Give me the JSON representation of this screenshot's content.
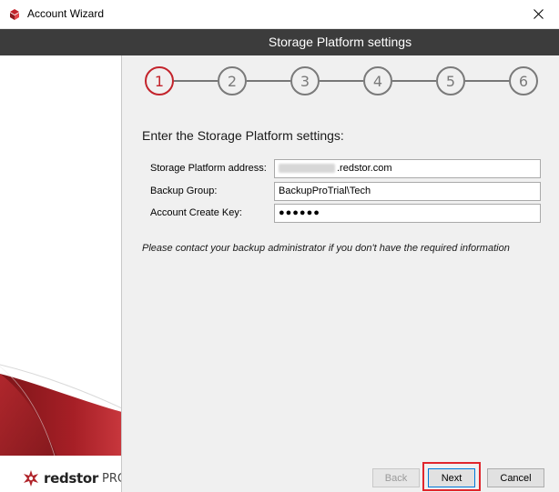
{
  "window": {
    "title": "Account Wizard"
  },
  "header": {
    "title": "Storage Platform settings"
  },
  "stepper": {
    "steps": [
      "1",
      "2",
      "3",
      "4",
      "5",
      "6"
    ],
    "active_index": 0,
    "active_color": "#c3232b",
    "inactive_color": "#7a7a7a"
  },
  "form": {
    "heading": "Enter the Storage Platform settings:",
    "fields": [
      {
        "label": "Storage Platform address:",
        "value": ".redstor.com"
      },
      {
        "label": "Backup Group:",
        "value": "BackupProTrial\\Tech"
      },
      {
        "label": "Account Create Key:",
        "value": "●●●●●●"
      }
    ],
    "note": "Please contact your backup administrator if you don't have the required information"
  },
  "buttons": {
    "back": "Back",
    "next": "Next",
    "cancel": "Cancel"
  },
  "branding": {
    "logo_word": "redstor",
    "logo_suffix": "PRO",
    "brand_color": "#a01e24"
  }
}
